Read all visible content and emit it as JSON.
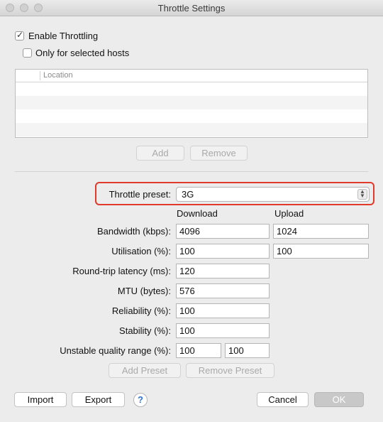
{
  "window": {
    "title": "Throttle Settings"
  },
  "throttling": {
    "enable_label": "Enable Throttling",
    "enable_checked": true,
    "selected_hosts_label": "Only for selected hosts",
    "selected_hosts_checked": false
  },
  "hosts_table": {
    "column_header": "Location",
    "rows": []
  },
  "hosts_buttons": {
    "add": "Add",
    "remove": "Remove"
  },
  "preset": {
    "label": "Throttle preset:",
    "value": "3G"
  },
  "columns": {
    "download": "Download",
    "upload": "Upload"
  },
  "fields": {
    "bandwidth": {
      "label": "Bandwidth (kbps):",
      "download": "4096",
      "upload": "1024"
    },
    "utilisation": {
      "label": "Utilisation (%):",
      "download": "100",
      "upload": "100"
    },
    "latency": {
      "label": "Round-trip latency (ms):",
      "value": "120"
    },
    "mtu": {
      "label": "MTU (bytes):",
      "value": "576"
    },
    "reliability": {
      "label": "Reliability (%):",
      "value": "100"
    },
    "stability": {
      "label": "Stability (%):",
      "value": "100"
    },
    "unstable_range": {
      "label": "Unstable quality range (%):",
      "min": "100",
      "max": "100"
    }
  },
  "preset_buttons": {
    "add": "Add Preset",
    "remove": "Remove Preset"
  },
  "footer": {
    "import": "Import",
    "export": "Export",
    "help": "?",
    "cancel": "Cancel",
    "ok": "OK"
  },
  "colors": {
    "highlight": "#e03a2a",
    "help_icon": "#2a72d8"
  }
}
